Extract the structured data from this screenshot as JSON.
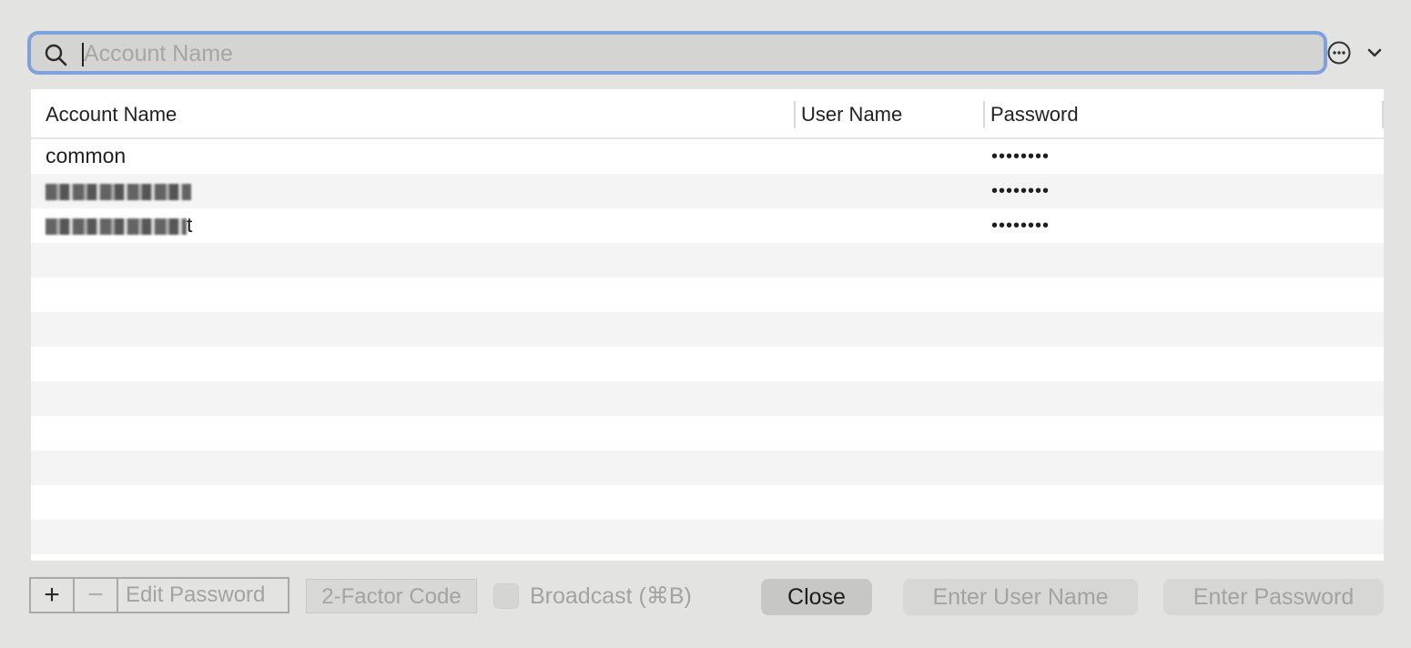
{
  "search": {
    "placeholder": "Account Name",
    "value": ""
  },
  "table": {
    "columns": [
      "Account Name",
      "User Name",
      "Password"
    ],
    "rows": [
      {
        "account": "common",
        "user": "",
        "password": "••••••••"
      },
      {
        "account": "",
        "user": "",
        "password": "••••••••"
      },
      {
        "account": "t",
        "user": "",
        "password": "••••••••"
      }
    ]
  },
  "toolbar": {
    "add_glyph": "+",
    "remove_glyph": "−",
    "edit_password": "Edit Password",
    "two_factor": "2-Factor Code",
    "broadcast": "Broadcast (⌘B)",
    "close": "Close",
    "enter_user_name": "Enter User Name",
    "enter_password": "Enter Password"
  },
  "colors": {
    "accent": "#7fa1dd",
    "background": "#e3e3e1"
  },
  "icons": [
    "search-icon",
    "more-options-icon",
    "chevron-down-icon"
  ]
}
